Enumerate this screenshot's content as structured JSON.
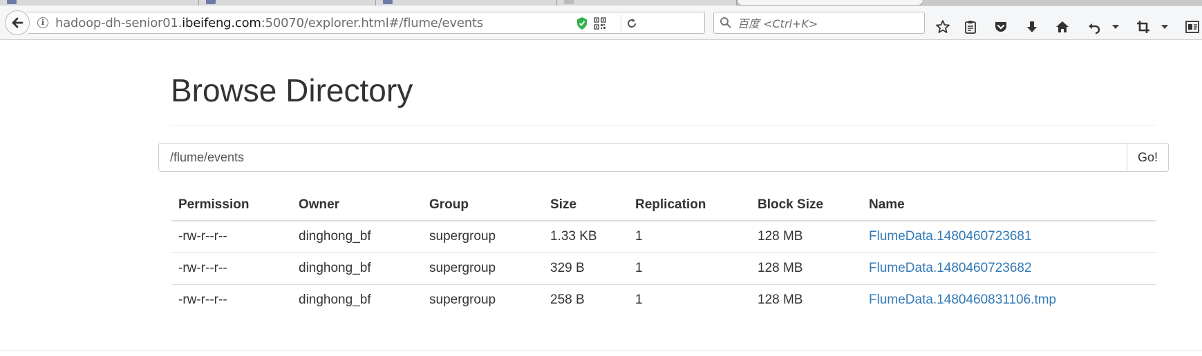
{
  "browser": {
    "url_prefix": "hadoop-dh-senior01.",
    "url_host": "ibeifeng.com",
    "url_suffix": ":50070/explorer.html#/flume/events",
    "search_placeholder": "百度 <Ctrl+K>"
  },
  "page": {
    "title": "Browse Directory",
    "path_value": "/flume/events",
    "go_label": "Go!"
  },
  "table": {
    "headers": [
      "Permission",
      "Owner",
      "Group",
      "Size",
      "Replication",
      "Block Size",
      "Name"
    ],
    "rows": [
      [
        "-rw-r--r--",
        "dinghong_bf",
        "supergroup",
        "1.33 KB",
        "1",
        "128 MB",
        "FlumeData.1480460723681"
      ],
      [
        "-rw-r--r--",
        "dinghong_bf",
        "supergroup",
        "329 B",
        "1",
        "128 MB",
        "FlumeData.1480460723682"
      ],
      [
        "-rw-r--r--",
        "dinghong_bf",
        "supergroup",
        "258 B",
        "1",
        "128 MB",
        "FlumeData.1480460831106.tmp"
      ]
    ]
  },
  "colors": {
    "link": "#337ab7",
    "text": "#333333",
    "shield": "#2fb24c"
  }
}
